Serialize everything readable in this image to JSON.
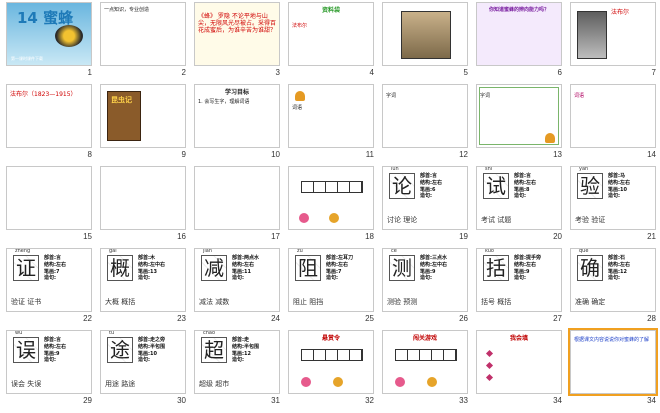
{
  "slides": [
    {
      "num": "1",
      "title": "14 蜜蜂",
      "text": "第一课时课件下载"
    },
    {
      "num": "2",
      "title": "",
      "text": "一点知识，专业创造"
    },
    {
      "num": "3",
      "title": "",
      "text": "《蜂》 罗隐 不论平地与山尖，无限风光尽被占。采得百花成蜜后，为谁辛苦为谁甜？"
    },
    {
      "num": "4",
      "title": "资料袋",
      "text": "法布尔"
    },
    {
      "num": "5",
      "title": "",
      "text": ""
    },
    {
      "num": "6",
      "title": "你知道蜜蜂的辨向能力吗？",
      "text": ""
    },
    {
      "num": "7",
      "title": "",
      "text": "法布尔"
    },
    {
      "num": "8",
      "title": "",
      "text": "法布尔（1823—1915）"
    },
    {
      "num": "9",
      "title": "",
      "text": "昆虫记"
    },
    {
      "num": "10",
      "title": "学习目标",
      "text": "1. 会写生字，理解词语"
    },
    {
      "num": "11",
      "title": "",
      "text": "词语"
    },
    {
      "num": "12",
      "title": "",
      "text": "字词"
    },
    {
      "num": "13",
      "title": "",
      "text": "字词"
    },
    {
      "num": "14",
      "title": "",
      "text": "词语"
    },
    {
      "num": "15",
      "title": "",
      "text": ""
    },
    {
      "num": "16",
      "title": "",
      "text": ""
    },
    {
      "num": "17",
      "title": "",
      "text": ""
    },
    {
      "num": "18",
      "title": "",
      "text": ""
    },
    {
      "num": "19",
      "title": "",
      "text": ""
    },
    {
      "num": "20",
      "title": "",
      "text": ""
    },
    {
      "num": "21",
      "title": "",
      "text": ""
    },
    {
      "num": "22",
      "title": "",
      "text": ""
    },
    {
      "num": "23",
      "title": "",
      "text": ""
    },
    {
      "num": "24",
      "title": "",
      "text": ""
    },
    {
      "num": "25",
      "title": "",
      "text": ""
    },
    {
      "num": "26",
      "title": "",
      "text": ""
    },
    {
      "num": "27",
      "title": "",
      "text": ""
    },
    {
      "num": "28",
      "title": "",
      "text": ""
    },
    {
      "num": "29",
      "title": "",
      "text": ""
    },
    {
      "num": "30",
      "title": "",
      "text": ""
    },
    {
      "num": "31",
      "title": "",
      "text": ""
    },
    {
      "num": "32",
      "title": "",
      "text": ""
    },
    {
      "num": "33",
      "title": "",
      "text": ""
    },
    {
      "num": "34",
      "title": "",
      "text": ""
    }
  ],
  "chars": {
    "s18": {
      "ch": "论",
      "py": "lùn",
      "info": [
        "部首:言",
        "结构:左右",
        "笔画:6",
        "造句:"
      ],
      "words": "讨论 理论"
    },
    "s19": {
      "ch": "试",
      "py": "shì",
      "info": [
        "部首:言",
        "结构:左右",
        "笔画:8",
        "造句:"
      ],
      "words": "考试 试题"
    },
    "s20": {
      "ch": "验",
      "py": "yàn",
      "info": [
        "部首:马",
        "结构:左右",
        "笔画:10",
        "造句:"
      ],
      "words": "考验 验证"
    },
    "s21": {
      "ch": "证",
      "py": "zhèng",
      "info": [
        "部首:言",
        "结构:左右",
        "笔画:7",
        "造句:"
      ],
      "words": "验证 证书"
    },
    "s22": {
      "ch": "概",
      "py": "gài",
      "info": [
        "部首:木",
        "结构:左中右",
        "笔画:13",
        "造句:"
      ],
      "words": "大概  概括"
    },
    "s23": {
      "ch": "减",
      "py": "jiǎn",
      "info": [
        "部首:两点水",
        "结构:左右",
        "笔画:11",
        "造句:"
      ],
      "words": "减法  减数"
    },
    "s24": {
      "ch": "阻",
      "py": "zǔ",
      "info": [
        "部首:左耳刀",
        "结构:左右",
        "笔画:7",
        "造句:"
      ],
      "words": "阻止 阻挡"
    },
    "s25": {
      "ch": "测",
      "py": "cè",
      "info": [
        "部首:三点水",
        "结构:左中右",
        "笔画:9",
        "造句:"
      ],
      "words": "测验  预测"
    },
    "s26": {
      "ch": "括",
      "py": "kuò",
      "info": [
        "部首:提手旁",
        "结构:左右",
        "笔画:9",
        "造句:"
      ],
      "words": "括号  概括"
    },
    "s27": {
      "ch": "确",
      "py": "què",
      "info": [
        "部首:石",
        "结构:左右",
        "笔画:12",
        "造句:"
      ],
      "words": "准确 确定"
    },
    "s28": {
      "ch": "误",
      "py": "wù",
      "info": [
        "部首:言",
        "结构:左右",
        "笔画:9",
        "造句:"
      ],
      "words": "误会 失误"
    },
    "s29": {
      "ch": "途",
      "py": "tú",
      "info": [
        "部首:走之旁",
        "结构:半包围",
        "笔画:10",
        "造句:"
      ],
      "words": "用途  路途"
    },
    "s30": {
      "ch": "超",
      "py": "chāo",
      "info": [
        "部首:走",
        "结构:半包围",
        "笔画:12",
        "造句:"
      ],
      "words": "超级  超市"
    }
  },
  "misc": {
    "s31": "悬赏令",
    "s32": "闯关游戏",
    "s33": "我会填",
    "s34": "根据课文内容说说你对蜜蜂的了解"
  },
  "colors": {
    "accent": "#f0a020",
    "char_border": "#555555",
    "slide_border": "#c8c8c8"
  }
}
